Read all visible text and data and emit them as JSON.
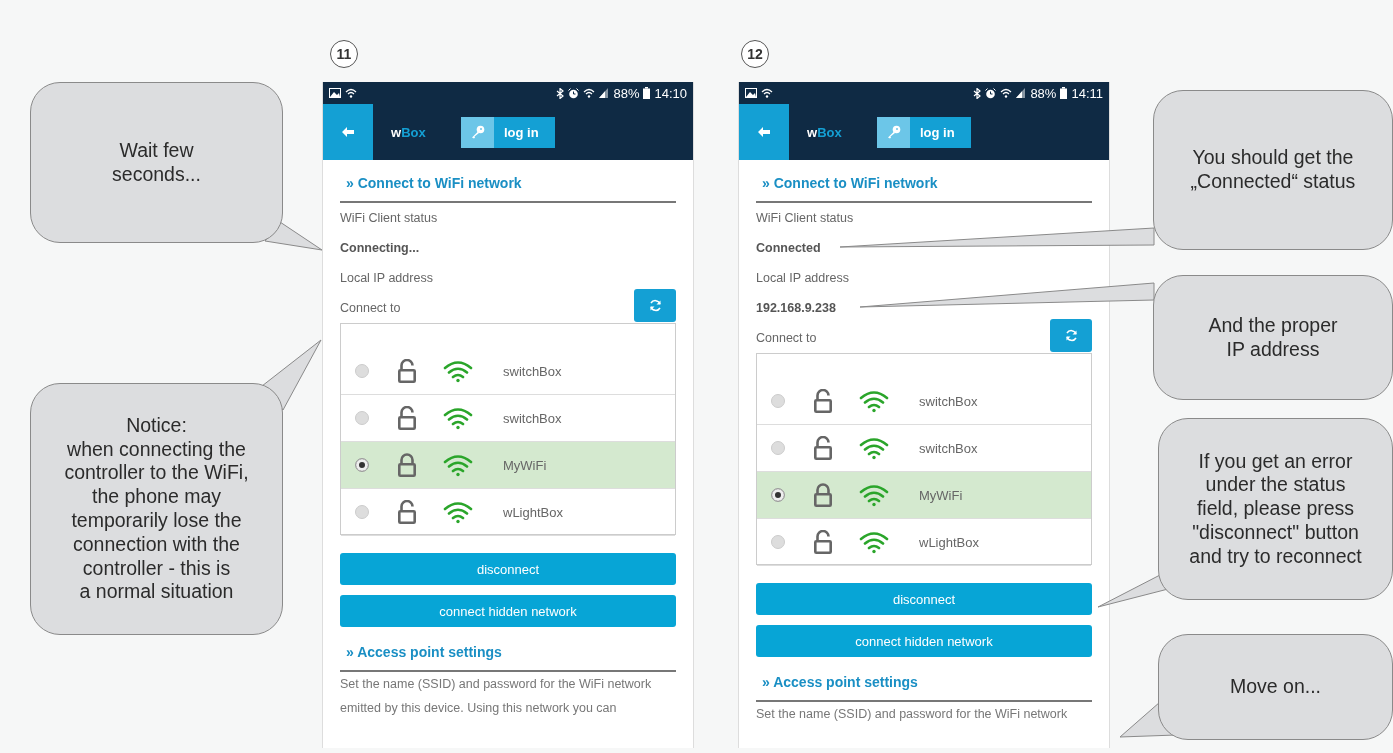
{
  "callouts_left": [
    {
      "text": "Wait few\nseconds..."
    },
    {
      "text": "Notice:\nwhen connecting the\ncontroller to the WiFi,\nthe phone may\ntemporarily lose the\nconnection with the\ncontroller - this is\na normal situation"
    }
  ],
  "phones": [
    {
      "step": "11",
      "battery": "88%",
      "time": "14:10",
      "app_name": "w**Box**",
      "login": "log in",
      "section_title": "» Connect to WiFi network",
      "status_label": "WiFi Client status",
      "status_value": "Connecting...",
      "ip_label": "Local IP address",
      "connect_label": "Connect to",
      "networks": [
        {
          "name": "switchBox",
          "selected": false,
          "locked": false
        },
        {
          "name": "switchBox",
          "selected": false,
          "locked": false
        },
        {
          "name": "MyWiFi",
          "selected": true,
          "locked": true
        },
        {
          "name": "wLightBox",
          "selected": false,
          "locked": false
        }
      ],
      "buttons": [
        "disconnect",
        "connect hidden network"
      ],
      "ap_title": "» Access point settings",
      "ap_lines": [
        "Set the name (SSID) and password for the WiFi network",
        "emitted by this device. Using this network you can"
      ]
    },
    {
      "step": "12",
      "battery": "88%",
      "time": "14:11",
      "app_name": "w**Box**",
      "login": "log in",
      "section_title": "» Connect to WiFi network",
      "status_label": "WiFi Client status",
      "status_value": "Connected",
      "ip_label": "Local IP address",
      "ip_value": "192.168.9.238",
      "connect_label": "Connect to",
      "networks": [
        {
          "name": "switchBox",
          "selected": false,
          "locked": false
        },
        {
          "name": "switchBox",
          "selected": false,
          "locked": false
        },
        {
          "name": "MyWiFi",
          "selected": true,
          "locked": true
        },
        {
          "name": "wLightBox",
          "selected": false,
          "locked": false
        }
      ],
      "buttons": [
        "disconnect",
        "connect hidden network"
      ],
      "ap_title": "» Access point settings",
      "ap_lines": [
        "Set the name (SSID) and password for the WiFi network"
      ]
    }
  ],
  "callouts_right": [
    {
      "text": "You should get the\n„Connected“ status"
    },
    {
      "text": "And the proper\nIP address"
    },
    {
      "text": "If you get an error\nunder the status\nfield, please press\n\"disconnect\" button\nand try to reconnect"
    },
    {
      "text": "Move on..."
    }
  ]
}
